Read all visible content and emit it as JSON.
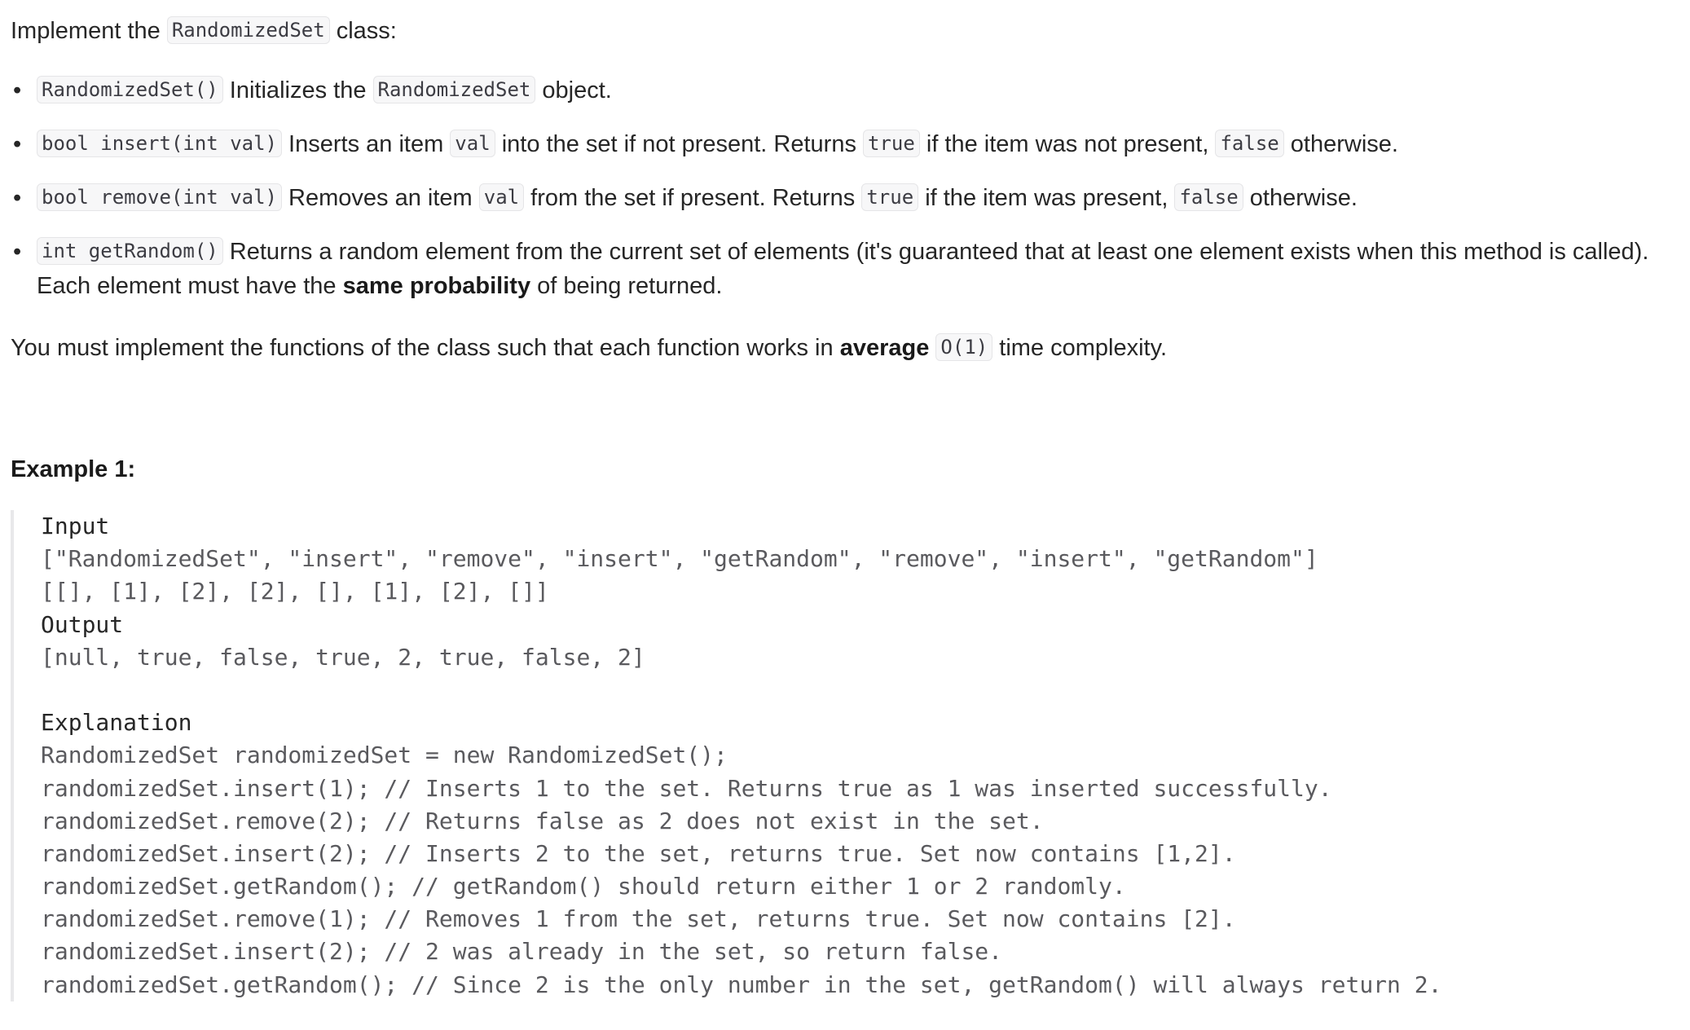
{
  "intro": {
    "prefix": "Implement the ",
    "class_name": "RandomizedSet",
    "suffix": " class:"
  },
  "methods": [
    {
      "signature": "RandomizedSet()",
      "parts": [
        " Initializes the ",
        "RandomizedSet",
        " object."
      ]
    },
    {
      "signature": "bool insert(int val)",
      "parts": [
        " Inserts an item ",
        "val",
        " into the set if not present. Returns ",
        "true",
        " if the item was not present, ",
        "false",
        " otherwise."
      ]
    },
    {
      "signature": "bool remove(int val)",
      "parts": [
        " Removes an item ",
        "val",
        " from the set if present. Returns ",
        "true",
        " if the item was present, ",
        "false",
        " otherwise."
      ]
    },
    {
      "signature": "int getRandom()",
      "parts": [
        " Returns a random element from the current set of elements (it's guaranteed that at least one element exists when this method is called). Each element must have the ",
        "same probability",
        " of being returned."
      ]
    }
  ],
  "complexity": {
    "prefix": "You must implement the functions of the class such that each function works in ",
    "bold": "average",
    "code": "O(1)",
    "suffix": " time complexity."
  },
  "example": {
    "title": "Example 1:",
    "input_label": "Input",
    "input_line1": "[\"RandomizedSet\", \"insert\", \"remove\", \"insert\", \"getRandom\", \"remove\", \"insert\", \"getRandom\"]",
    "input_line2": "[[], [1], [2], [2], [], [1], [2], []]",
    "output_label": "Output",
    "output_line": "[null, true, false, true, 2, true, false, 2]",
    "explanation_label": "Explanation",
    "explanation_lines": [
      "RandomizedSet randomizedSet = new RandomizedSet();",
      "randomizedSet.insert(1); // Inserts 1 to the set. Returns true as 1 was inserted successfully.",
      "randomizedSet.remove(2); // Returns false as 2 does not exist in the set.",
      "randomizedSet.insert(2); // Inserts 2 to the set, returns true. Set now contains [1,2].",
      "randomizedSet.getRandom(); // getRandom() should return either 1 or 2 randomly.",
      "randomizedSet.remove(1); // Removes 1 from the set, returns true. Set now contains [2].",
      "randomizedSet.insert(2); // 2 was already in the set, so return false.",
      "randomizedSet.getRandom(); // Since 2 is the only number in the set, getRandom() will always return 2."
    ]
  }
}
